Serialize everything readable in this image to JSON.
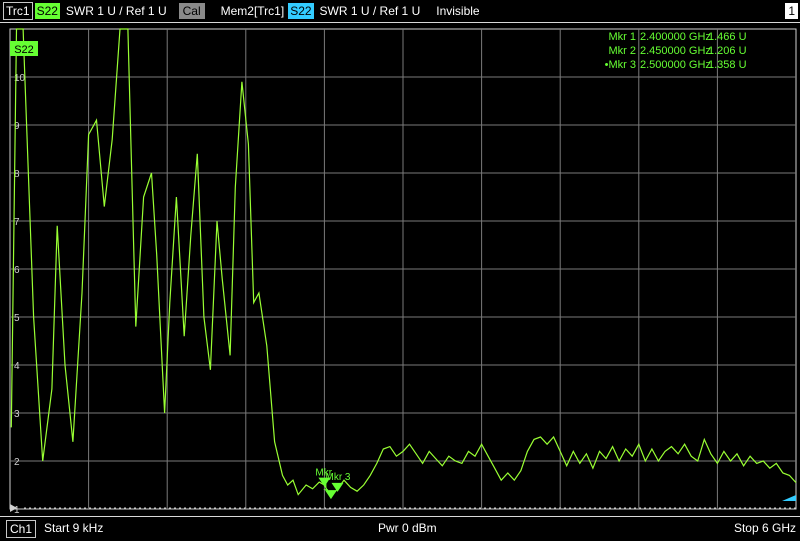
{
  "header": {
    "trace_label": "Trc1",
    "param": "S22",
    "format": "SWR  1 U /  Ref 1 U",
    "cal_label": "Cal",
    "mem_label": "Mem2[Trc1]",
    "mem_param": "S22",
    "mem_format": "SWR  1 U /  Ref 1 U",
    "mem_state": "Invisible",
    "channel_index": "1"
  },
  "trace_tag": "S22",
  "markers": [
    {
      "name": "Mkr 1",
      "freq": "2.400000 GHz",
      "value": "1.466 U",
      "active": false
    },
    {
      "name": "Mkr 2",
      "freq": "2.450000 GHz",
      "value": "1.206 U",
      "active": false
    },
    {
      "name": "Mkr 3",
      "freq": "2.500000 GHz",
      "value": "1.358 U",
      "active": true
    }
  ],
  "marker_flags": {
    "m1": "Mkr",
    "m2": "1",
    "m3": "Mkr 3"
  },
  "footer": {
    "channel": "Ch1",
    "start": "Start  9 kHz",
    "power": "Pwr  0 dBm",
    "stop": "Stop  6 GHz"
  },
  "chart_data": {
    "type": "line",
    "xlim_ghz": [
      9e-06,
      6
    ],
    "ylim": [
      1,
      11
    ],
    "yticks": [
      1,
      2,
      3,
      4,
      5,
      6,
      7,
      8,
      9,
      10
    ],
    "grid": true,
    "series": [
      {
        "color": "#99ff33",
        "x": [
          0.01,
          0.05,
          0.1,
          0.18,
          0.25,
          0.32,
          0.36,
          0.42,
          0.48,
          0.55,
          0.6,
          0.66,
          0.72,
          0.78,
          0.84,
          0.9,
          0.96,
          1.02,
          1.08,
          1.12,
          1.18,
          1.22,
          1.27,
          1.33,
          1.38,
          1.43,
          1.48,
          1.53,
          1.58,
          1.62,
          1.68,
          1.72,
          1.77,
          1.82,
          1.86,
          1.9,
          1.96,
          2.02,
          2.08,
          2.12,
          2.16,
          2.2,
          2.26,
          2.31,
          2.36,
          2.4,
          2.45,
          2.5,
          2.55,
          2.6,
          2.65,
          2.7,
          2.75,
          2.8,
          2.85,
          2.9,
          2.95,
          3.0,
          3.05,
          3.1,
          3.15,
          3.2,
          3.25,
          3.3,
          3.35,
          3.4,
          3.45,
          3.5,
          3.55,
          3.6,
          3.65,
          3.7,
          3.75,
          3.8,
          3.85,
          3.9,
          3.95,
          4.0,
          4.05,
          4.1,
          4.15,
          4.2,
          4.25,
          4.3,
          4.35,
          4.4,
          4.45,
          4.5,
          4.55,
          4.6,
          4.65,
          4.7,
          4.75,
          4.8,
          4.85,
          4.9,
          4.95,
          5.0,
          5.05,
          5.1,
          5.15,
          5.2,
          5.25,
          5.3,
          5.35,
          5.4,
          5.45,
          5.5,
          5.55,
          5.6,
          5.65,
          5.7,
          5.75,
          5.8,
          5.85,
          5.9,
          5.95,
          6.0
        ],
        "y": [
          2.7,
          11,
          11,
          5.0,
          2.0,
          3.5,
          6.9,
          4.0,
          2.4,
          5.5,
          8.8,
          9.1,
          7.3,
          8.7,
          11,
          11,
          4.8,
          7.5,
          8.0,
          6.3,
          3.0,
          5.3,
          7.5,
          4.6,
          6.7,
          8.4,
          5.0,
          3.9,
          7.0,
          5.8,
          4.2,
          7.7,
          9.9,
          8.6,
          5.3,
          5.5,
          4.4,
          2.4,
          1.7,
          1.5,
          1.6,
          1.3,
          1.5,
          1.42,
          1.56,
          1.5,
          1.25,
          1.42,
          1.6,
          1.45,
          1.37,
          1.5,
          1.7,
          1.95,
          2.25,
          2.3,
          2.1,
          2.2,
          2.35,
          2.15,
          1.95,
          2.2,
          2.05,
          1.9,
          2.1,
          2.0,
          1.95,
          2.2,
          2.1,
          2.35,
          2.1,
          1.85,
          1.6,
          1.75,
          1.6,
          1.8,
          2.2,
          2.45,
          2.5,
          2.35,
          2.5,
          2.2,
          1.9,
          2.2,
          1.95,
          2.15,
          1.85,
          2.2,
          2.05,
          2.3,
          2.0,
          2.25,
          2.1,
          2.35,
          2.0,
          2.25,
          2.0,
          2.2,
          2.3,
          2.15,
          2.35,
          2.1,
          2.0,
          2.45,
          2.15,
          1.95,
          2.2,
          2.0,
          2.15,
          1.9,
          2.1,
          1.95,
          2.0,
          1.85,
          1.95,
          1.75,
          1.7,
          1.55
        ]
      }
    ]
  }
}
